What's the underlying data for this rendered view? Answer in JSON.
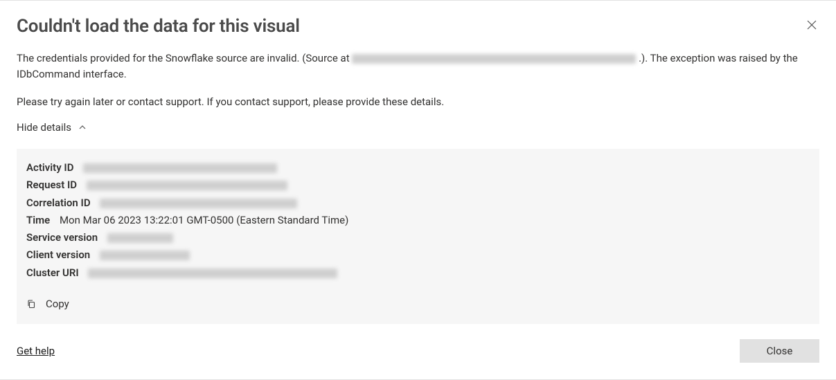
{
  "title": "Couldn't load the data for this visual",
  "message": {
    "prefix": "The credentials provided for the Snowflake source are invalid. (Source at ",
    "suffix": ".). The exception was raised by the IDbCommand interface."
  },
  "retry_msg": "Please try again later or contact support. If you contact support, please provide these details.",
  "toggle_label": "Hide details",
  "details": {
    "activity_id_label": "Activity ID",
    "request_id_label": "Request ID",
    "correlation_id_label": "Correlation ID",
    "time_label": "Time",
    "time_value": "Mon Mar 06 2023 13:22:01 GMT-0500 (Eastern Standard Time)",
    "service_version_label": "Service version",
    "client_version_label": "Client version",
    "cluster_uri_label": "Cluster URI"
  },
  "copy_label": "Copy",
  "help_label": "Get help",
  "close_label": "Close"
}
